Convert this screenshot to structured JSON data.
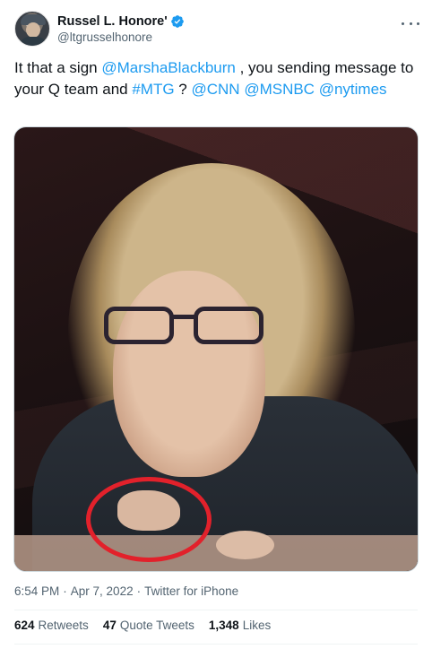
{
  "tweet": {
    "author": {
      "display_name": "Russel L. Honore'",
      "handle": "@ltgrusselhonore",
      "verified": true
    },
    "text": {
      "part1": "It that a sign ",
      "mention1": "@MarshaBlackburn",
      "part2": " , you sending message to your Q team and ",
      "hashtag1": "#MTG",
      "part3": " ? ",
      "mention2": "@CNN",
      "space1": " ",
      "mention3": "@MSNBC",
      "space2": " ",
      "mention4": "@nytimes"
    },
    "media": {
      "description_icon": "photo",
      "annotation_color": "#e2212b"
    },
    "meta": {
      "time": "6:54 PM",
      "sep1": "·",
      "date": "Apr 7, 2022",
      "sep2": "·",
      "source": "Twitter for iPhone"
    },
    "stats": {
      "retweets_count": "624",
      "retweets_label": "Retweets",
      "quotes_count": "47",
      "quotes_label": "Quote Tweets",
      "likes_count": "1,348",
      "likes_label": "Likes"
    }
  },
  "colors": {
    "link": "#1d9bf0",
    "text_primary": "#0f1419",
    "text_secondary": "#536471",
    "verified": "#1d9bf0"
  }
}
